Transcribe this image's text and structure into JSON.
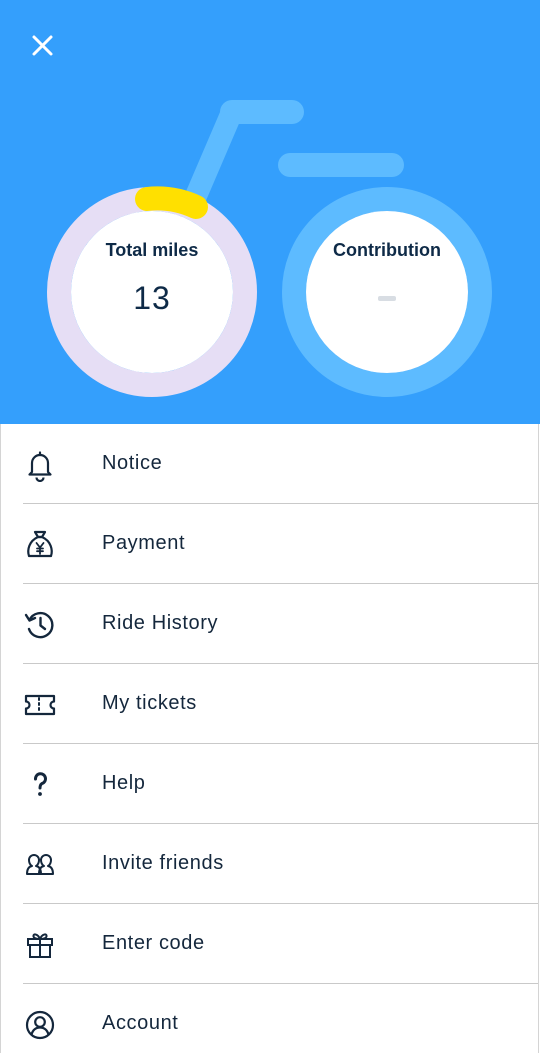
{
  "header": {
    "close_icon": "close-icon",
    "colors": {
      "background": "#349ffc",
      "accent_yellow": "#ffe000",
      "progress_ring": "#e6def5",
      "wheel_light": "#5dbbff"
    },
    "stats": {
      "total_miles_label": "Total miles",
      "total_miles_value": "13",
      "contribution_label": "Contribution",
      "contribution_value": ""
    }
  },
  "menu": {
    "items": [
      {
        "label": "Notice",
        "icon": "bell-icon"
      },
      {
        "label": "Payment",
        "icon": "money-bag-icon"
      },
      {
        "label": "Ride History",
        "icon": "history-icon"
      },
      {
        "label": "My tickets",
        "icon": "ticket-icon"
      },
      {
        "label": "Help",
        "icon": "question-icon"
      },
      {
        "label": "Invite friends",
        "icon": "friends-icon"
      },
      {
        "label": "Enter code",
        "icon": "gift-icon"
      },
      {
        "label": "Account",
        "icon": "account-icon"
      }
    ]
  }
}
